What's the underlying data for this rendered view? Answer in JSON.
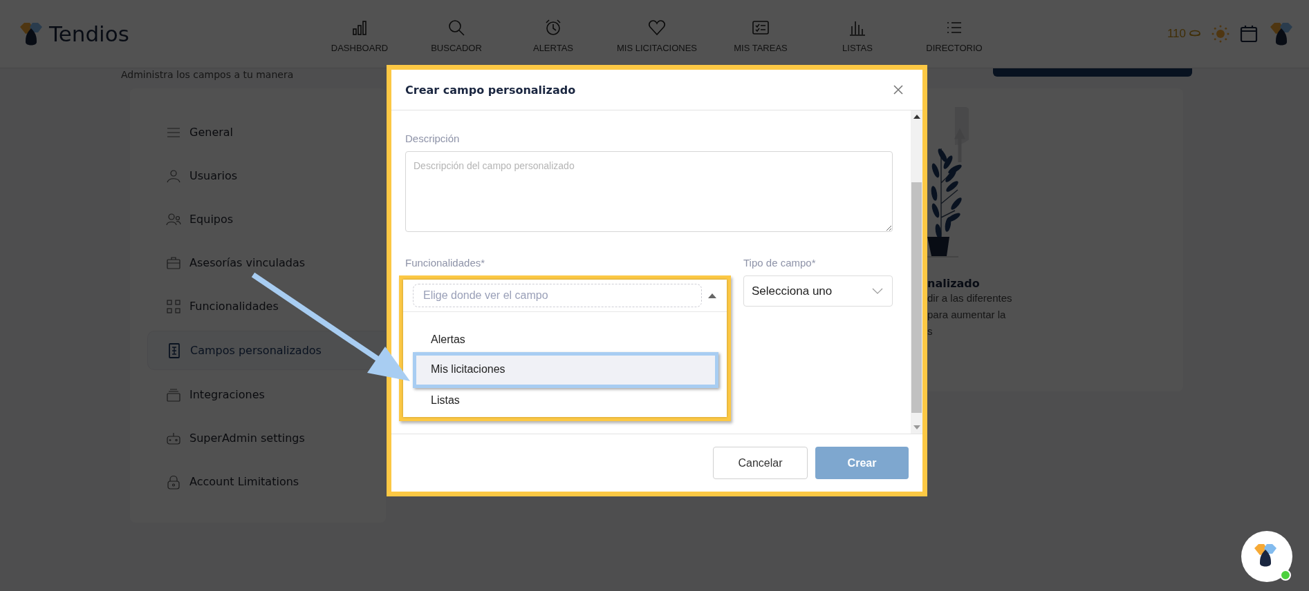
{
  "header": {
    "logo": "Tendios",
    "nav": [
      {
        "label": "DASHBOARD"
      },
      {
        "label": "BUSCADOR"
      },
      {
        "label": "ALERTAS"
      },
      {
        "label": "MIS LICITACIONES"
      },
      {
        "label": "MIS TAREAS"
      },
      {
        "label": "LISTAS"
      },
      {
        "label": "DIRECTORIO"
      }
    ],
    "coins": "110"
  },
  "page": {
    "subtitle": "Administra los campos a tu manera"
  },
  "sidebar": {
    "items": [
      {
        "label": "General",
        "selected": false
      },
      {
        "label": "Usuarios",
        "selected": false
      },
      {
        "label": "Equipos",
        "selected": false
      },
      {
        "label": "Asesorías vinculadas",
        "selected": false
      },
      {
        "label": "Funcionalidades",
        "selected": false
      },
      {
        "label": "Campos personalizados",
        "selected": true
      },
      {
        "label": "Integraciones",
        "selected": false
      },
      {
        "label": "SuperAdmin settings",
        "selected": false
      },
      {
        "label": "Account Limitations",
        "selected": false
      }
    ]
  },
  "content": {
    "title": "nalizado",
    "lines": [
      "dir a las diferentes",
      "para aumentar la",
      "s"
    ]
  },
  "modal": {
    "title": "Crear campo personalizado",
    "description": {
      "label": "Descripción",
      "placeholder": "Descripción del campo personalizado"
    },
    "features": {
      "label": "Funcionalidades*",
      "placeholder": "Elige donde ver el campo",
      "expanded": true,
      "options": [
        {
          "label": "Alertas",
          "selected": false
        },
        {
          "label": "Mis licitaciones",
          "selected": true
        },
        {
          "label": "Listas",
          "selected": false
        }
      ]
    },
    "field_type": {
      "label": "Tipo de campo*",
      "value": "Selecciona uno"
    },
    "buttons": [
      {
        "label": "Cancelar",
        "kind": "secondary"
      },
      {
        "label": "Crear",
        "kind": "primary"
      }
    ]
  }
}
